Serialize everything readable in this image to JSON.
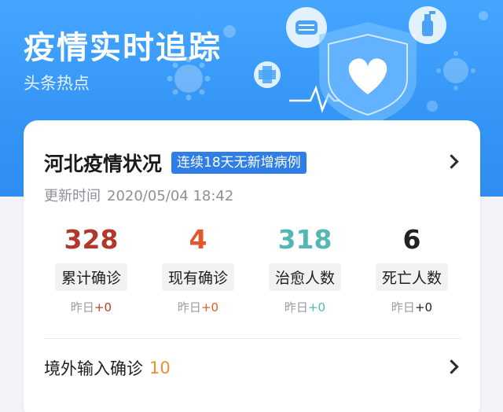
{
  "banner": {
    "title": "疫情实时追踪",
    "subtitle": "头条热点",
    "background_color": "#3a9cf9",
    "decor_icons": [
      "mask-icon",
      "shield-heart-icon",
      "virus-icon",
      "cross-icon",
      "sanitizer-icon",
      "heartbeat-icon"
    ]
  },
  "card": {
    "region_title": "河北疫情状况",
    "badge": "连续18天无新增病例",
    "update_label": "更新时间",
    "update_time": "2020/05/04 18:42",
    "stats": [
      {
        "value": "328",
        "label": "累计确诊",
        "delta_prefix": "昨日",
        "delta": "+0",
        "color": "#b2372d",
        "delta_color": "#c0392b"
      },
      {
        "value": "4",
        "label": "现有确诊",
        "delta_prefix": "昨日",
        "delta": "+0",
        "color": "#e05a2b",
        "delta_color": "#e05a2b"
      },
      {
        "value": "318",
        "label": "治愈人数",
        "delta_prefix": "昨日",
        "delta": "+0",
        "color": "#52b7b5",
        "delta_color": "#52b7b5"
      },
      {
        "value": "6",
        "label": "死亡人数",
        "delta_prefix": "昨日",
        "delta": "+0",
        "color": "#222222",
        "delta_color": "#222222"
      }
    ],
    "imported": {
      "label": "境外输入确诊",
      "count": "10"
    }
  }
}
